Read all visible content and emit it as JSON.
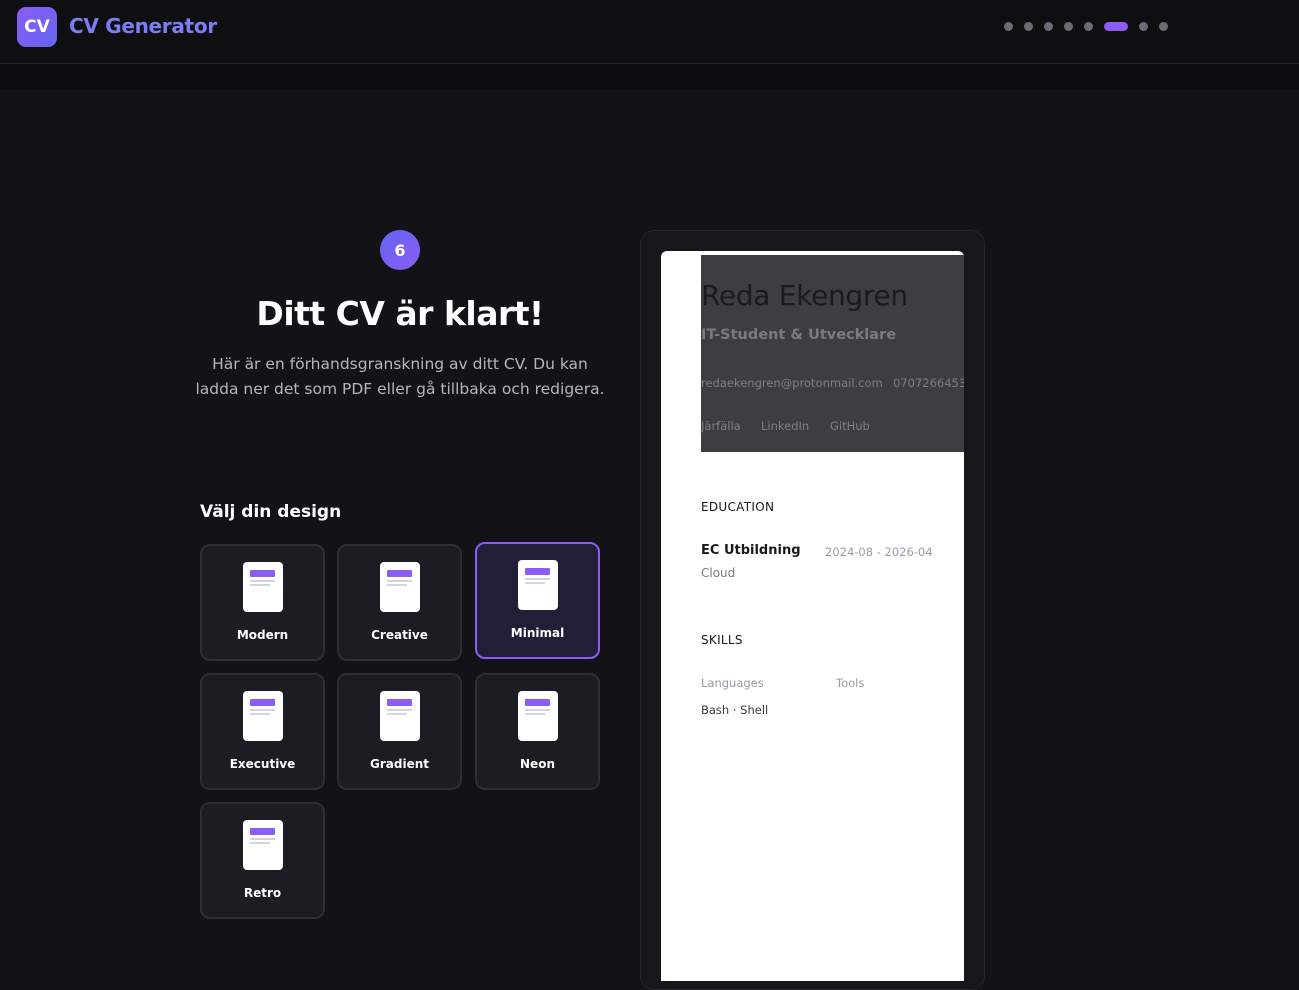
{
  "app": {
    "logo_text": "CV",
    "title": "CV Generator"
  },
  "steps": {
    "total": 9,
    "active_index": 5
  },
  "step_badge": "6",
  "hero": {
    "title": "Ditt CV är klart!",
    "description": "Här är en förhandsgranskning av ditt CV. Du kan ladda ner det som PDF eller gå tillbaka och redigera."
  },
  "design": {
    "heading": "Välj din design",
    "selected": "Minimal",
    "options": [
      "Modern",
      "Creative",
      "Minimal",
      "Executive",
      "Gradient",
      "Neon",
      "Retro"
    ]
  },
  "cv": {
    "name": "Reda Ekengren",
    "role": "IT-Student & Utvecklare",
    "email": "redaekengren@protonmail.com",
    "phone": "0707266453",
    "location": "Järfälla",
    "linkedin": "LinkedIn",
    "github": "GitHub",
    "education_title": "EDUCATION",
    "education": {
      "school": "EC Utbildning",
      "dates": "2024-08 - 2026-04",
      "program": "Cloud"
    },
    "skills_title": "SKILLS",
    "skills_languages_label": "Languages",
    "skills_tools_label": "Tools",
    "skills_languages": "Bash · Shell"
  },
  "colors": {
    "accent": "#8b5cf6",
    "background": "#131317",
    "card": "#1c1c22"
  }
}
